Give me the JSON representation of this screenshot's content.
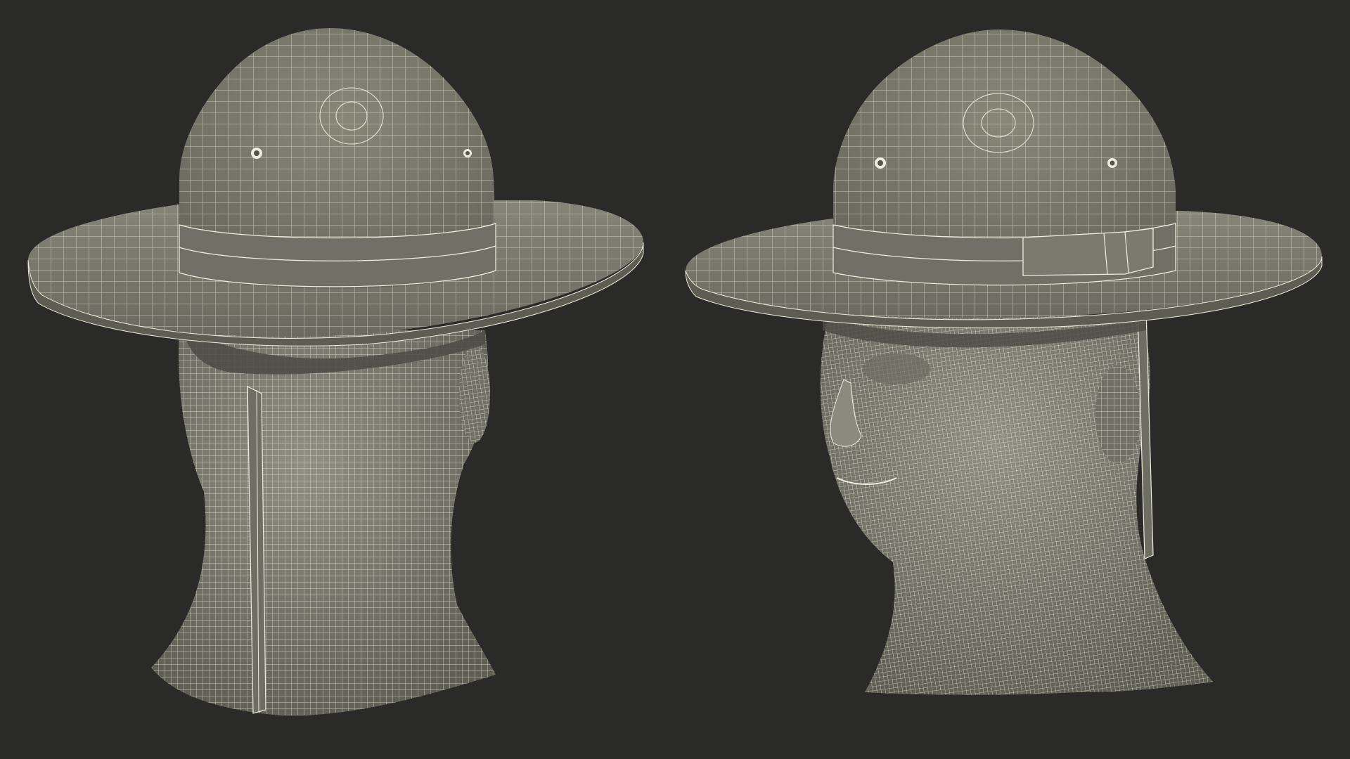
{
  "scene": {
    "background": "#2a2a29",
    "mesh_fill": "#7d7d71",
    "mesh_fill_light": "#8f8f83",
    "mesh_fill_dark": "#5e5e55",
    "wire_color": "#eeeedf",
    "views": [
      {
        "name": "back-view",
        "subject": "campaign-hat-on-head-wireframe"
      },
      {
        "name": "front-three-quarter-view",
        "subject": "campaign-hat-on-head-wireframe"
      }
    ]
  }
}
